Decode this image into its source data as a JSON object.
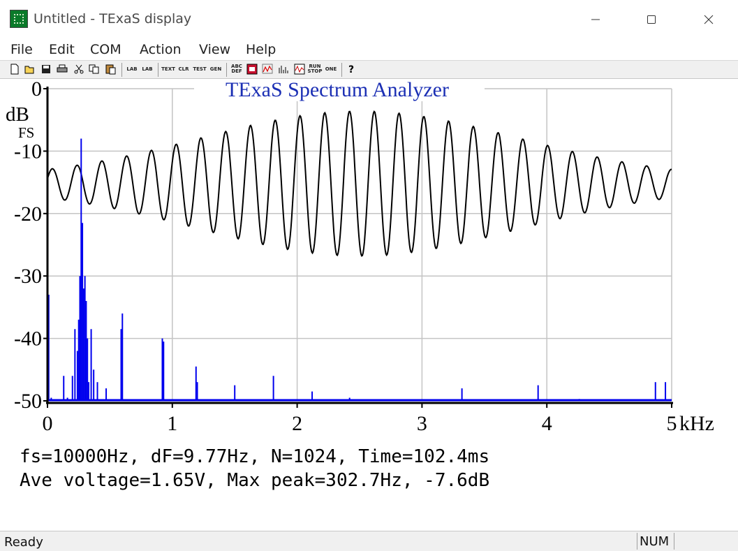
{
  "window": {
    "title": "Untitled - TExaS display"
  },
  "menu": {
    "items": [
      "File",
      "Edit",
      "COM",
      "Action",
      "View",
      "Help"
    ]
  },
  "toolbar": {
    "buttons": [
      "new-icon",
      "open-icon",
      "save-icon",
      "print-icon",
      "cut-icon",
      "copy-icon",
      "paste-icon",
      "LAB",
      "LAB",
      "TEXT",
      "CLR",
      "TEST",
      "GEN",
      "ABC DEF",
      "record-icon",
      "scope-icon",
      "spectrum-icon",
      "meter-icon",
      "RUN STOP",
      "ONE",
      "help-icon"
    ]
  },
  "spectrum": {
    "title": "TExaS Spectrum Analyzer",
    "ylabel": "dB",
    "ylabel2": "FS",
    "xunit": "kHz",
    "info_line1": "fs=10000Hz, dF=9.77Hz, N=1024, Time=102.4ms",
    "info_line2": "Ave voltage=1.65V, Max peak=302.7Hz, -7.6dB"
  },
  "status": {
    "text": "Ready",
    "num": "NUM"
  },
  "chart_data": [
    {
      "type": "bar",
      "title": "TExaS Spectrum Analyzer",
      "ylabel": "dB FS",
      "xlabel": "kHz",
      "xlim": [
        0,
        5
      ],
      "ylim": [
        -50,
        0
      ],
      "xticks": [
        "0",
        "1",
        "2",
        "3",
        "4",
        "5"
      ],
      "yticks": [
        "0",
        "-10",
        "-20",
        "-30",
        "-40",
        "-50"
      ],
      "grid": true,
      "color": "#0000ee",
      "x": [
        0.0,
        0.01,
        0.03,
        0.13,
        0.16,
        0.2,
        0.22,
        0.24,
        0.25,
        0.26,
        0.27,
        0.28,
        0.29,
        0.3,
        0.31,
        0.32,
        0.33,
        0.35,
        0.37,
        0.4,
        0.47,
        0.59,
        0.6,
        0.92,
        0.93,
        1.19,
        1.2,
        1.5,
        1.81,
        2.12,
        2.42,
        3.32,
        3.93,
        4.26,
        4.87,
        4.95
      ],
      "values": [
        -50,
        -33,
        -49.5,
        -46,
        -49.5,
        -46,
        -38.5,
        -42,
        -37,
        -30,
        -8,
        -21.5,
        -32,
        -30,
        -34,
        -40,
        -47,
        -38.5,
        -45,
        -47,
        -48,
        -38.5,
        -36,
        -40,
        -40.5,
        -44.5,
        -47,
        -47.5,
        -46,
        -48.5,
        -49.5,
        -48,
        -47.5,
        -49.7,
        -47,
        -47
      ]
    },
    {
      "type": "line",
      "description_of_shape": "time-domain waveform overlay",
      "color": "#000000",
      "envelope": "carrier 25 cycles with gaussian amplitude envelope, y range approx -27 to -3.5"
    }
  ]
}
